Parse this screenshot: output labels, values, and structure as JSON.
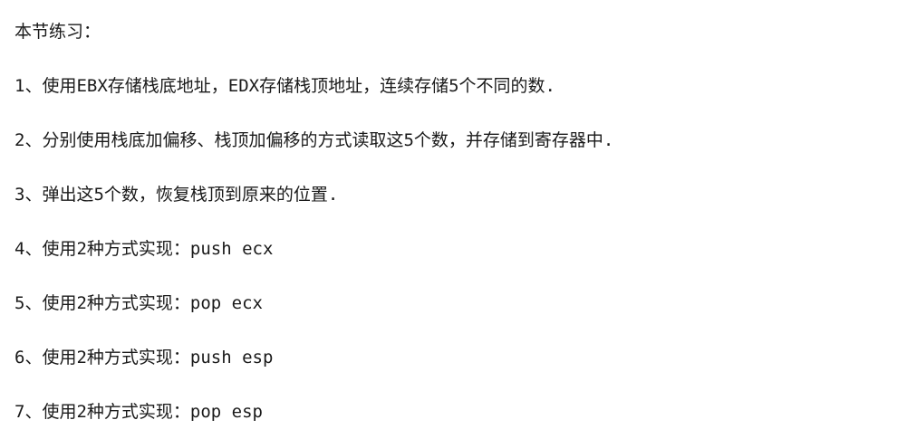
{
  "document": {
    "title": "本节练习：",
    "items": [
      "1、使用EBX存储栈底地址，EDX存储栈顶地址，连续存储5个不同的数.",
      "2、分别使用栈底加偏移、栈顶加偏移的方式读取这5个数，并存储到寄存器中.",
      "3、弹出这5个数，恢复栈顶到原来的位置.",
      "4、使用2种方式实现：push ecx",
      "5、使用2种方式实现：pop ecx",
      "6、使用2种方式实现：push esp",
      "7、使用2种方式实现：pop esp"
    ]
  }
}
